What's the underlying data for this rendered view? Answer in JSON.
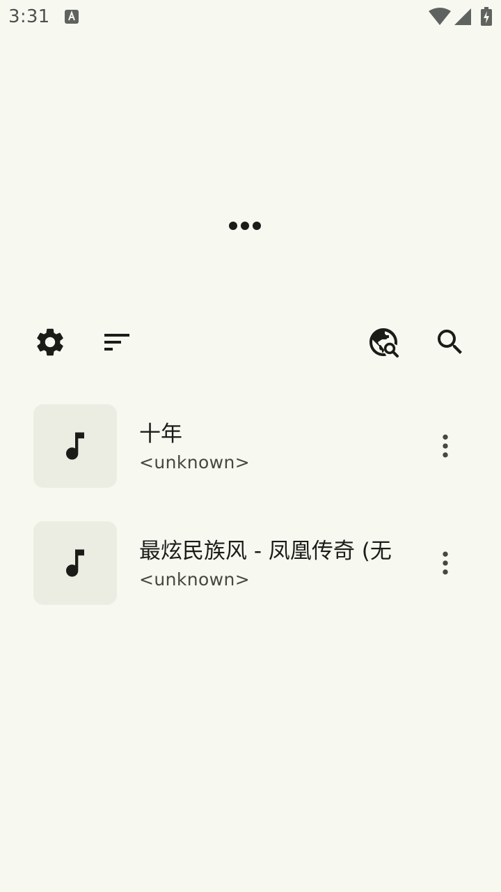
{
  "status_bar": {
    "time": "3:31",
    "app_icon": "a-text-notification-icon",
    "wifi_icon": "wifi-icon",
    "signal_icon": "cell-signal-icon",
    "battery_icon": "battery-charging-icon"
  },
  "player": {
    "loading_icon": "more-horizontal-icon"
  },
  "toolbar": {
    "settings_icon": "gear-icon",
    "sort_icon": "sort-icon",
    "online_search_icon": "web-search-icon",
    "search_icon": "search-icon"
  },
  "songs": [
    {
      "title": "十年",
      "artist": "<unknown>",
      "art_icon": "music-note-icon",
      "menu_icon": "more-vertical-icon"
    },
    {
      "title": "最炫民族风 - 凤凰传奇 (无",
      "artist": "<unknown>",
      "art_icon": "music-note-icon",
      "menu_icon": "more-vertical-icon"
    }
  ],
  "colors": {
    "background": "#f7f8f0",
    "art_tile": "#ecede2",
    "icon": "#1b1c18",
    "secondary_text": "#46483f"
  }
}
